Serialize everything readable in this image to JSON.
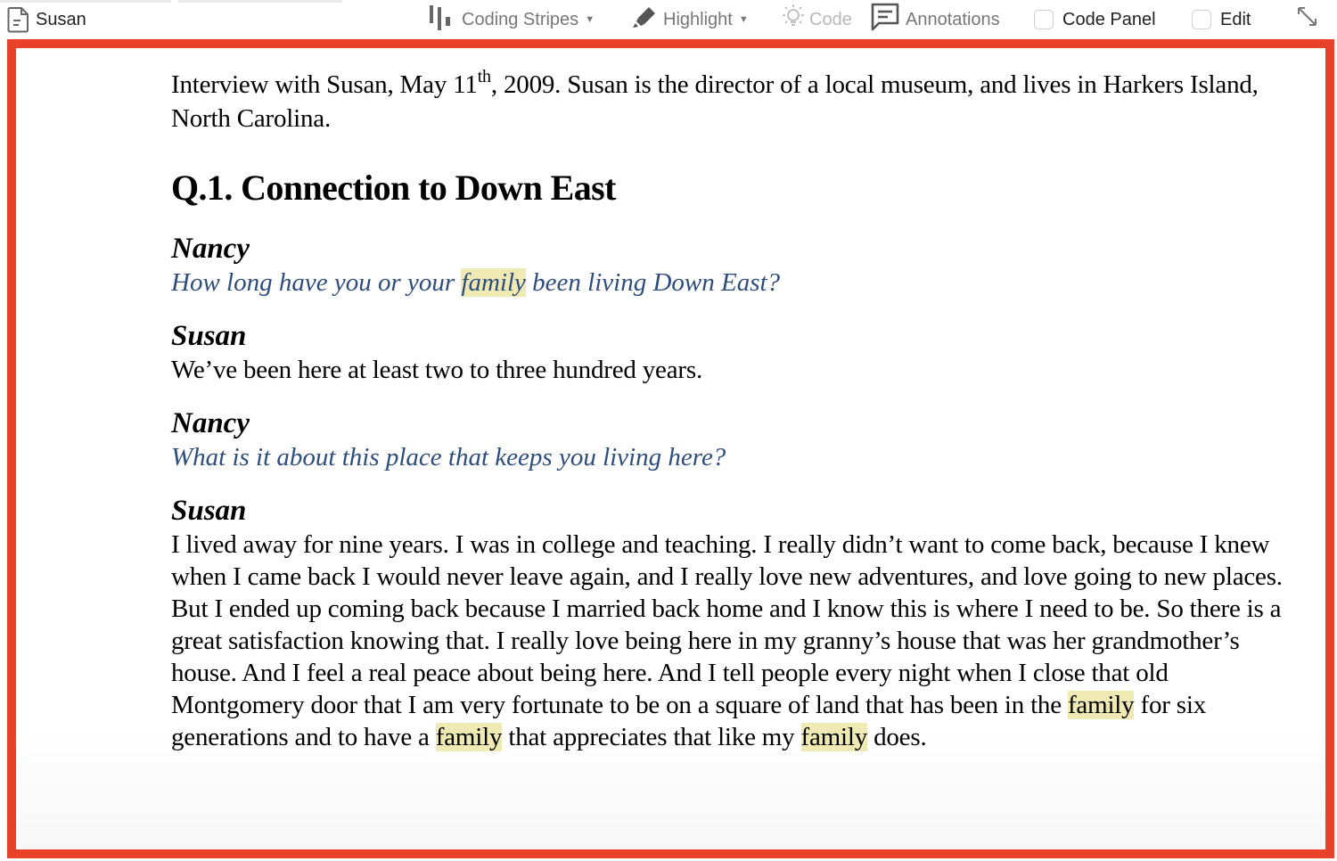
{
  "toolbar": {
    "document_name": "Susan",
    "coding_stripes_label": "Coding Stripes",
    "highlight_label": "Highlight",
    "code_label": "Code",
    "annotations_label": "Annotations",
    "code_panel_label": "Code Panel",
    "code_panel_checked": false,
    "edit_label": "Edit",
    "edit_checked": false,
    "icons": {
      "document": "document-icon",
      "coding_stripes": "coding-stripes-icon",
      "highlight": "highlighter-icon",
      "code": "lightbulb-icon",
      "annotations": "comment-icon",
      "expand": "expand-arrows-icon"
    }
  },
  "colors": {
    "frame_border": "#e8432a",
    "question_text": "#2e4d7f",
    "highlight": "#efeab4"
  },
  "document": {
    "intro_pre": "Interview with Susan, May 11",
    "intro_sup": "th",
    "intro_post": ", 2009.  Susan is the director of a local museum, and lives in Harkers Island, North Carolina.",
    "heading": "Q.1. Connection to Down East",
    "blocks": [
      {
        "speaker": "Nancy",
        "type": "question",
        "segments": [
          "How long have you or your ",
          "family",
          " been living Down East?"
        ]
      },
      {
        "speaker": "Susan",
        "type": "answer",
        "text": "We’ve been here at least two to three hundred years."
      },
      {
        "speaker": "Nancy",
        "type": "question",
        "text": "What is it about this place that keeps you living here?"
      },
      {
        "speaker": "Susan",
        "type": "answer",
        "segments": [
          "I lived away for nine years. I was in college and teaching. I really didn’t want to come back, because I knew when I came back I would never leave again, and I really love new adventures, and love going to new places. But I ended up coming back because I married back home and I know this is where I need to be. So there is a great satisfaction knowing that. I really love being here in my granny’s house that was her grandmother’s house. And I feel a real peace about being here. And I tell people every night when I close that old Montgomery door that I am very fortunate to be on a square of land that has been in the ",
          "family",
          " for six generations and to have a ",
          "family",
          " that appreciates that like my ",
          "family",
          " does."
        ]
      }
    ],
    "highlighted_term": "family"
  }
}
